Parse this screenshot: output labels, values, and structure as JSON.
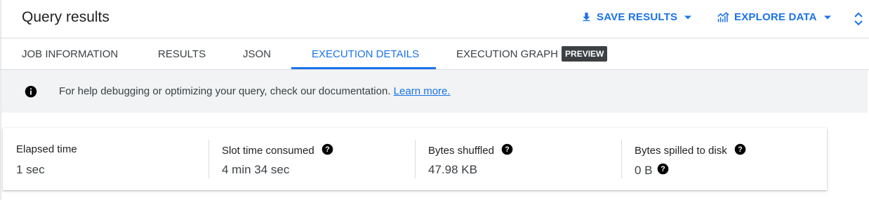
{
  "header": {
    "title": "Query results",
    "save_results_label": "SAVE RESULTS",
    "explore_data_label": "EXPLORE DATA",
    "icons": [
      "download-icon",
      "chart-icon",
      "caret-down-icon",
      "unfold-icon"
    ]
  },
  "tabs": [
    {
      "label": "JOB INFORMATION",
      "active": false
    },
    {
      "label": "RESULTS",
      "active": false
    },
    {
      "label": "JSON",
      "active": false
    },
    {
      "label": "EXECUTION DETAILS",
      "active": true
    },
    {
      "label": "EXECUTION GRAPH",
      "active": false,
      "badge": "PREVIEW"
    }
  ],
  "banner": {
    "text": "For help debugging or optimizing your query, check our documentation.",
    "link_label": "Learn more."
  },
  "stats": [
    {
      "label": "Elapsed time",
      "value": "1 sec",
      "help": false
    },
    {
      "label": "Slot time consumed",
      "value": "4 min 34 sec",
      "help": true
    },
    {
      "label": "Bytes shuffled",
      "value": "47.98 KB",
      "help": true
    },
    {
      "label": "Bytes spilled to disk",
      "value": "0 B",
      "help": true,
      "value_help": true
    }
  ],
  "colors": {
    "accent": "#1a73e8",
    "badge_bg": "#3c4043",
    "banner_bg": "#f1f3f4"
  }
}
